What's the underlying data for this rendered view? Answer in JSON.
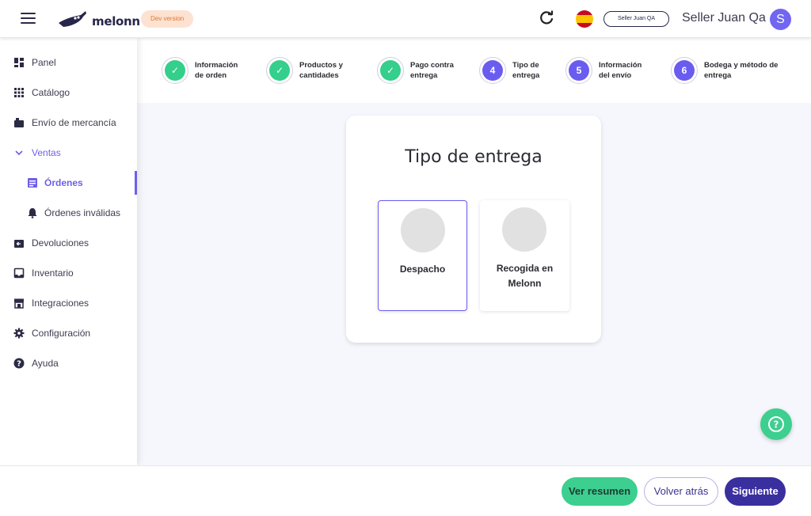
{
  "header": {
    "brand": "melonn",
    "dev_badge": "Dev version",
    "seller_pill": "Seller Juan QA",
    "user_name": "Seller Juan Qa",
    "avatar_letter": "S"
  },
  "sidebar": {
    "items": [
      {
        "label": "Panel",
        "icon": "dashboard-icon"
      },
      {
        "label": "Catálogo",
        "icon": "grid-dots-icon"
      },
      {
        "label": "Envío de mercancía",
        "icon": "package-icon"
      },
      {
        "label": "Ventas",
        "icon": "chevron-down-icon"
      },
      {
        "label": "Órdenes",
        "icon": "document-list-icon"
      },
      {
        "label": "Órdenes inválidas",
        "icon": "bell-alert-icon"
      },
      {
        "label": "Devoluciones",
        "icon": "return-box-icon"
      },
      {
        "label": "Inventario",
        "icon": "inbox-icon"
      },
      {
        "label": "Integraciones",
        "icon": "store-icon"
      },
      {
        "label": "Configuración",
        "icon": "gear-icon"
      },
      {
        "label": "Ayuda",
        "icon": "help-circle-icon"
      }
    ]
  },
  "stepper": {
    "steps": [
      {
        "label": "Información\nde orden",
        "state": "done"
      },
      {
        "label": "Productos y\ncantidades",
        "state": "done"
      },
      {
        "label": "Pago contra\nentrega",
        "state": "done"
      },
      {
        "number": "4",
        "label": "Tipo de\nentrega",
        "state": "current"
      },
      {
        "number": "5",
        "label": "Información\ndel envío",
        "state": "pending"
      },
      {
        "number": "6",
        "label": "Bodega y método de\nentrega",
        "state": "pending"
      }
    ]
  },
  "main": {
    "title": "Tipo de entrega",
    "options": [
      {
        "label": "Despacho",
        "selected": true
      },
      {
        "label": "Recogida en\nMelonn",
        "selected": false
      }
    ]
  },
  "footer": {
    "summary_label": "Ver resumen",
    "back_label": "Volver atrás",
    "next_label": "Siguiente"
  },
  "colors": {
    "accent": "#6a5cf0",
    "success": "#3dcf8f",
    "primary_dark": "#3a2f9e"
  }
}
